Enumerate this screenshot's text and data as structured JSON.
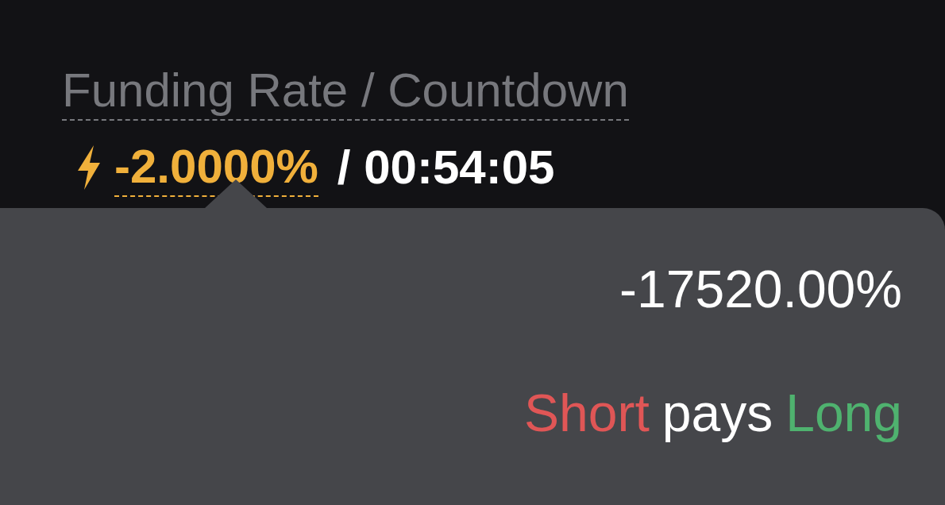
{
  "header": {
    "label": "Funding Rate / Countdown",
    "rate": "-2.0000%",
    "countdown": "/ 00:54:05"
  },
  "tooltip": {
    "annualized": "-17520.00%",
    "direction": [
      {
        "text": "Short",
        "color": "#e05656"
      },
      {
        "text": "pays",
        "color": "#ffffff"
      },
      {
        "text": "Long",
        "color": "#4fb26f"
      }
    ]
  }
}
